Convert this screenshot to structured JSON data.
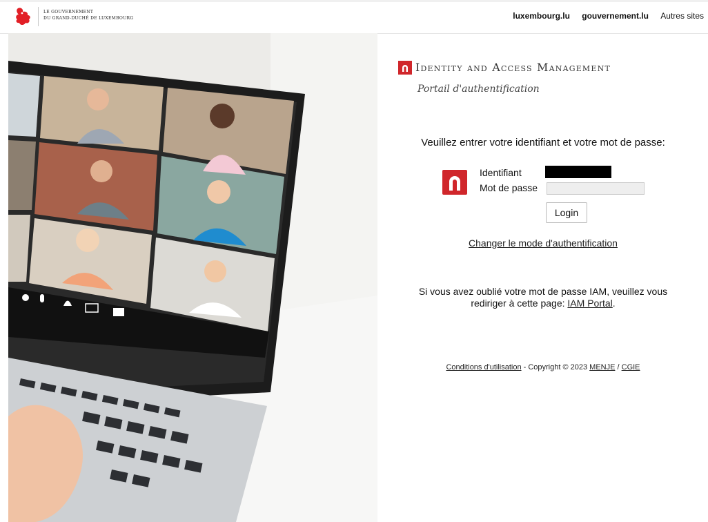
{
  "header": {
    "gov_line1": "LE GOUVERNEMENT",
    "gov_line2": "DU GRAND-DUCHÉ DE LUXEMBOURG",
    "links": [
      "luxembourg.lu",
      "gouvernement.lu",
      "Autres sites"
    ]
  },
  "brand": {
    "title": "Identity and Access Management",
    "subtitle": "Portail d'authentification",
    "accent_color": "#d0262b"
  },
  "login": {
    "instruction": "Veuillez entrer votre identifiant et votre mot de passe:",
    "username_label": "Identifiant",
    "password_label": "Mot de passe",
    "username_value": "",
    "password_value": "",
    "submit_label": "Login",
    "change_mode": "Changer le mode d'authentification"
  },
  "forgot": {
    "line1": "Si vous avez oublié votre mot de passe IAM, veuillez vous",
    "line2_prefix": "rediriger à cette page: ",
    "link": "IAM Portal",
    "line2_suffix": "."
  },
  "footer": {
    "conditions": "Conditions d'utilisation",
    "copyright": " - Copyright © 2023 ",
    "menje": "MENJE",
    "sep": " / ",
    "cgie": "CGIE"
  },
  "icons": {
    "gov_logo": "red-lion-icon",
    "brand": "iam-logo-icon",
    "media_controls": [
      "volume-icon",
      "microphone-icon",
      "person-icon",
      "screen-icon",
      "camera-icon"
    ]
  }
}
